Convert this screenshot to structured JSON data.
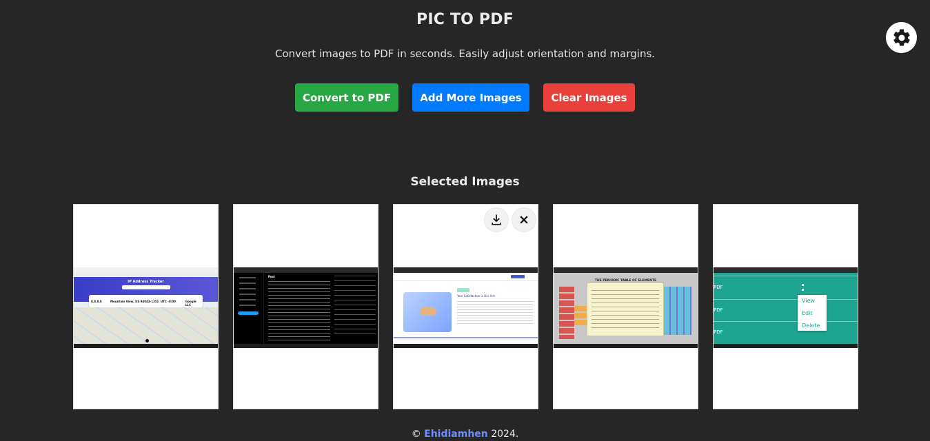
{
  "header": {
    "title": "PIC TO PDF",
    "subtitle": "Convert images to PDF in seconds. Easily adjust orientation and margins.",
    "settings_icon": "gear-icon"
  },
  "actions": {
    "convert_label": "Convert to PDF",
    "add_label": "Add More Images",
    "clear_label": "Clear Images"
  },
  "colors": {
    "background": "#262626",
    "convert": "#28a745",
    "add": "#007bff",
    "clear": "#e9403b",
    "link": "#6b8cff"
  },
  "gallery": {
    "title": "Selected Images",
    "images": [
      {
        "name": "ip-tracker-screenshot",
        "heading": "IP Address Tracker",
        "values": [
          "8.8.8.8",
          "Mountain View, US 94043-1351",
          "UTC -8:00",
          "Google LLC"
        ]
      },
      {
        "name": "x-social-screenshot",
        "heading": "Post"
      },
      {
        "name": "landing-page-screenshot",
        "heading": "Your Satisfaction is Our Aim",
        "hovered": true
      },
      {
        "name": "periodic-table-screenshot",
        "heading": "THE PERIODIC TABLE OF ELEMENTS"
      },
      {
        "name": "pdf-list-screenshot",
        "rows": [
          "PDF",
          "PDF",
          "PDF"
        ],
        "menu": [
          "View",
          "Edit",
          "Delete"
        ]
      }
    ],
    "card_actions": {
      "download_icon": "download-icon",
      "remove_icon": "close-icon"
    }
  },
  "footer": {
    "prefix": "© ",
    "author": "Ehidiamhen",
    "suffix": " 2024."
  }
}
